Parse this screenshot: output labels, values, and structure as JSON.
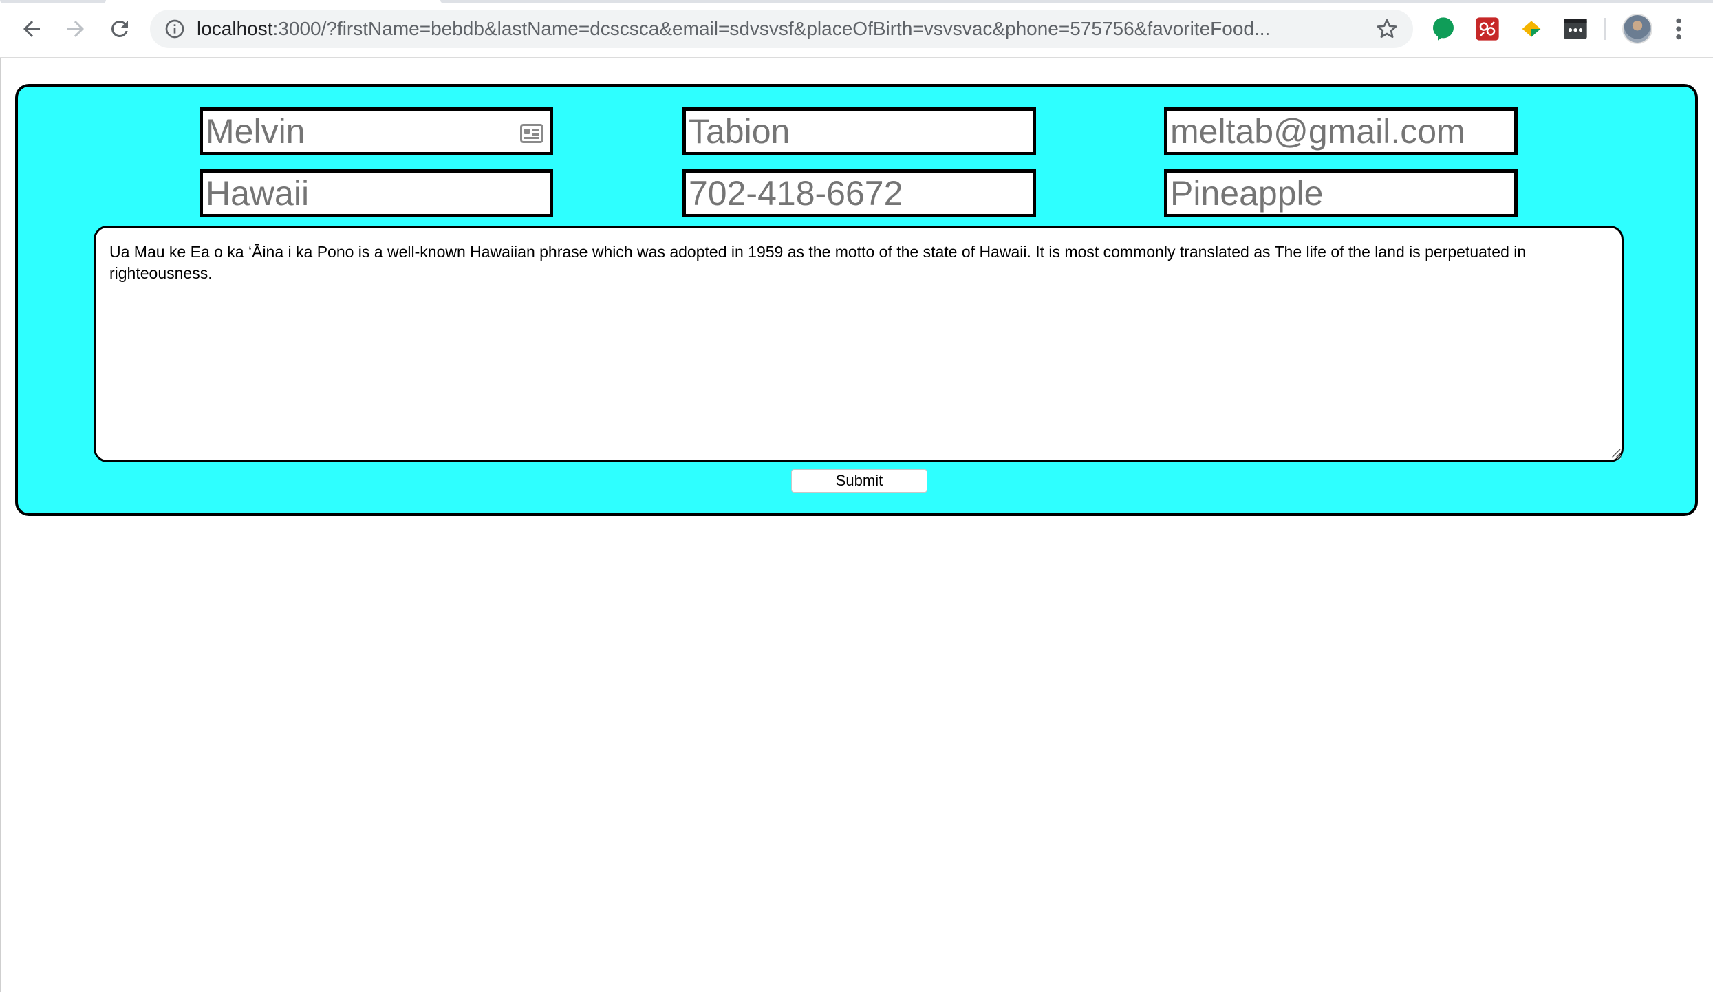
{
  "browser": {
    "url_host": "localhost",
    "url_rest": ":3000/?firstName=bebdb&lastName=dcscsca&email=sdvsvsf&placeOfBirth=vsvsvac&phone=575756&favoriteFood...",
    "icons": {
      "back": "back-arrow-icon",
      "forward": "forward-arrow-icon",
      "reload": "reload-icon",
      "site_info": "info-icon",
      "bookmark": "star-icon",
      "menu": "kebab-menu-icon"
    },
    "extensions": [
      "green-chat-icon",
      "red-bug-icon",
      "yellow-diamond-icon",
      "password-dots-icon"
    ]
  },
  "form": {
    "panel_color": "#2effff",
    "fields": {
      "first_name": {
        "placeholder": "Melvin"
      },
      "last_name": {
        "placeholder": "Tabion"
      },
      "email": {
        "placeholder": "meltab@gmail.com"
      },
      "place_of_birth": {
        "placeholder": "Hawaii"
      },
      "phone": {
        "placeholder": "702-418-6672"
      },
      "favorite_food": {
        "placeholder": "Pineapple"
      }
    },
    "message": "Ua Mau ke Ea o ka ʻĀina i ka Pono is a well-known Hawaiian phrase which was adopted in 1959 as the motto of the state of Hawaii. It is most commonly translated as The life of the land is perpetuated in righteousness.",
    "submit_label": "Submit"
  }
}
